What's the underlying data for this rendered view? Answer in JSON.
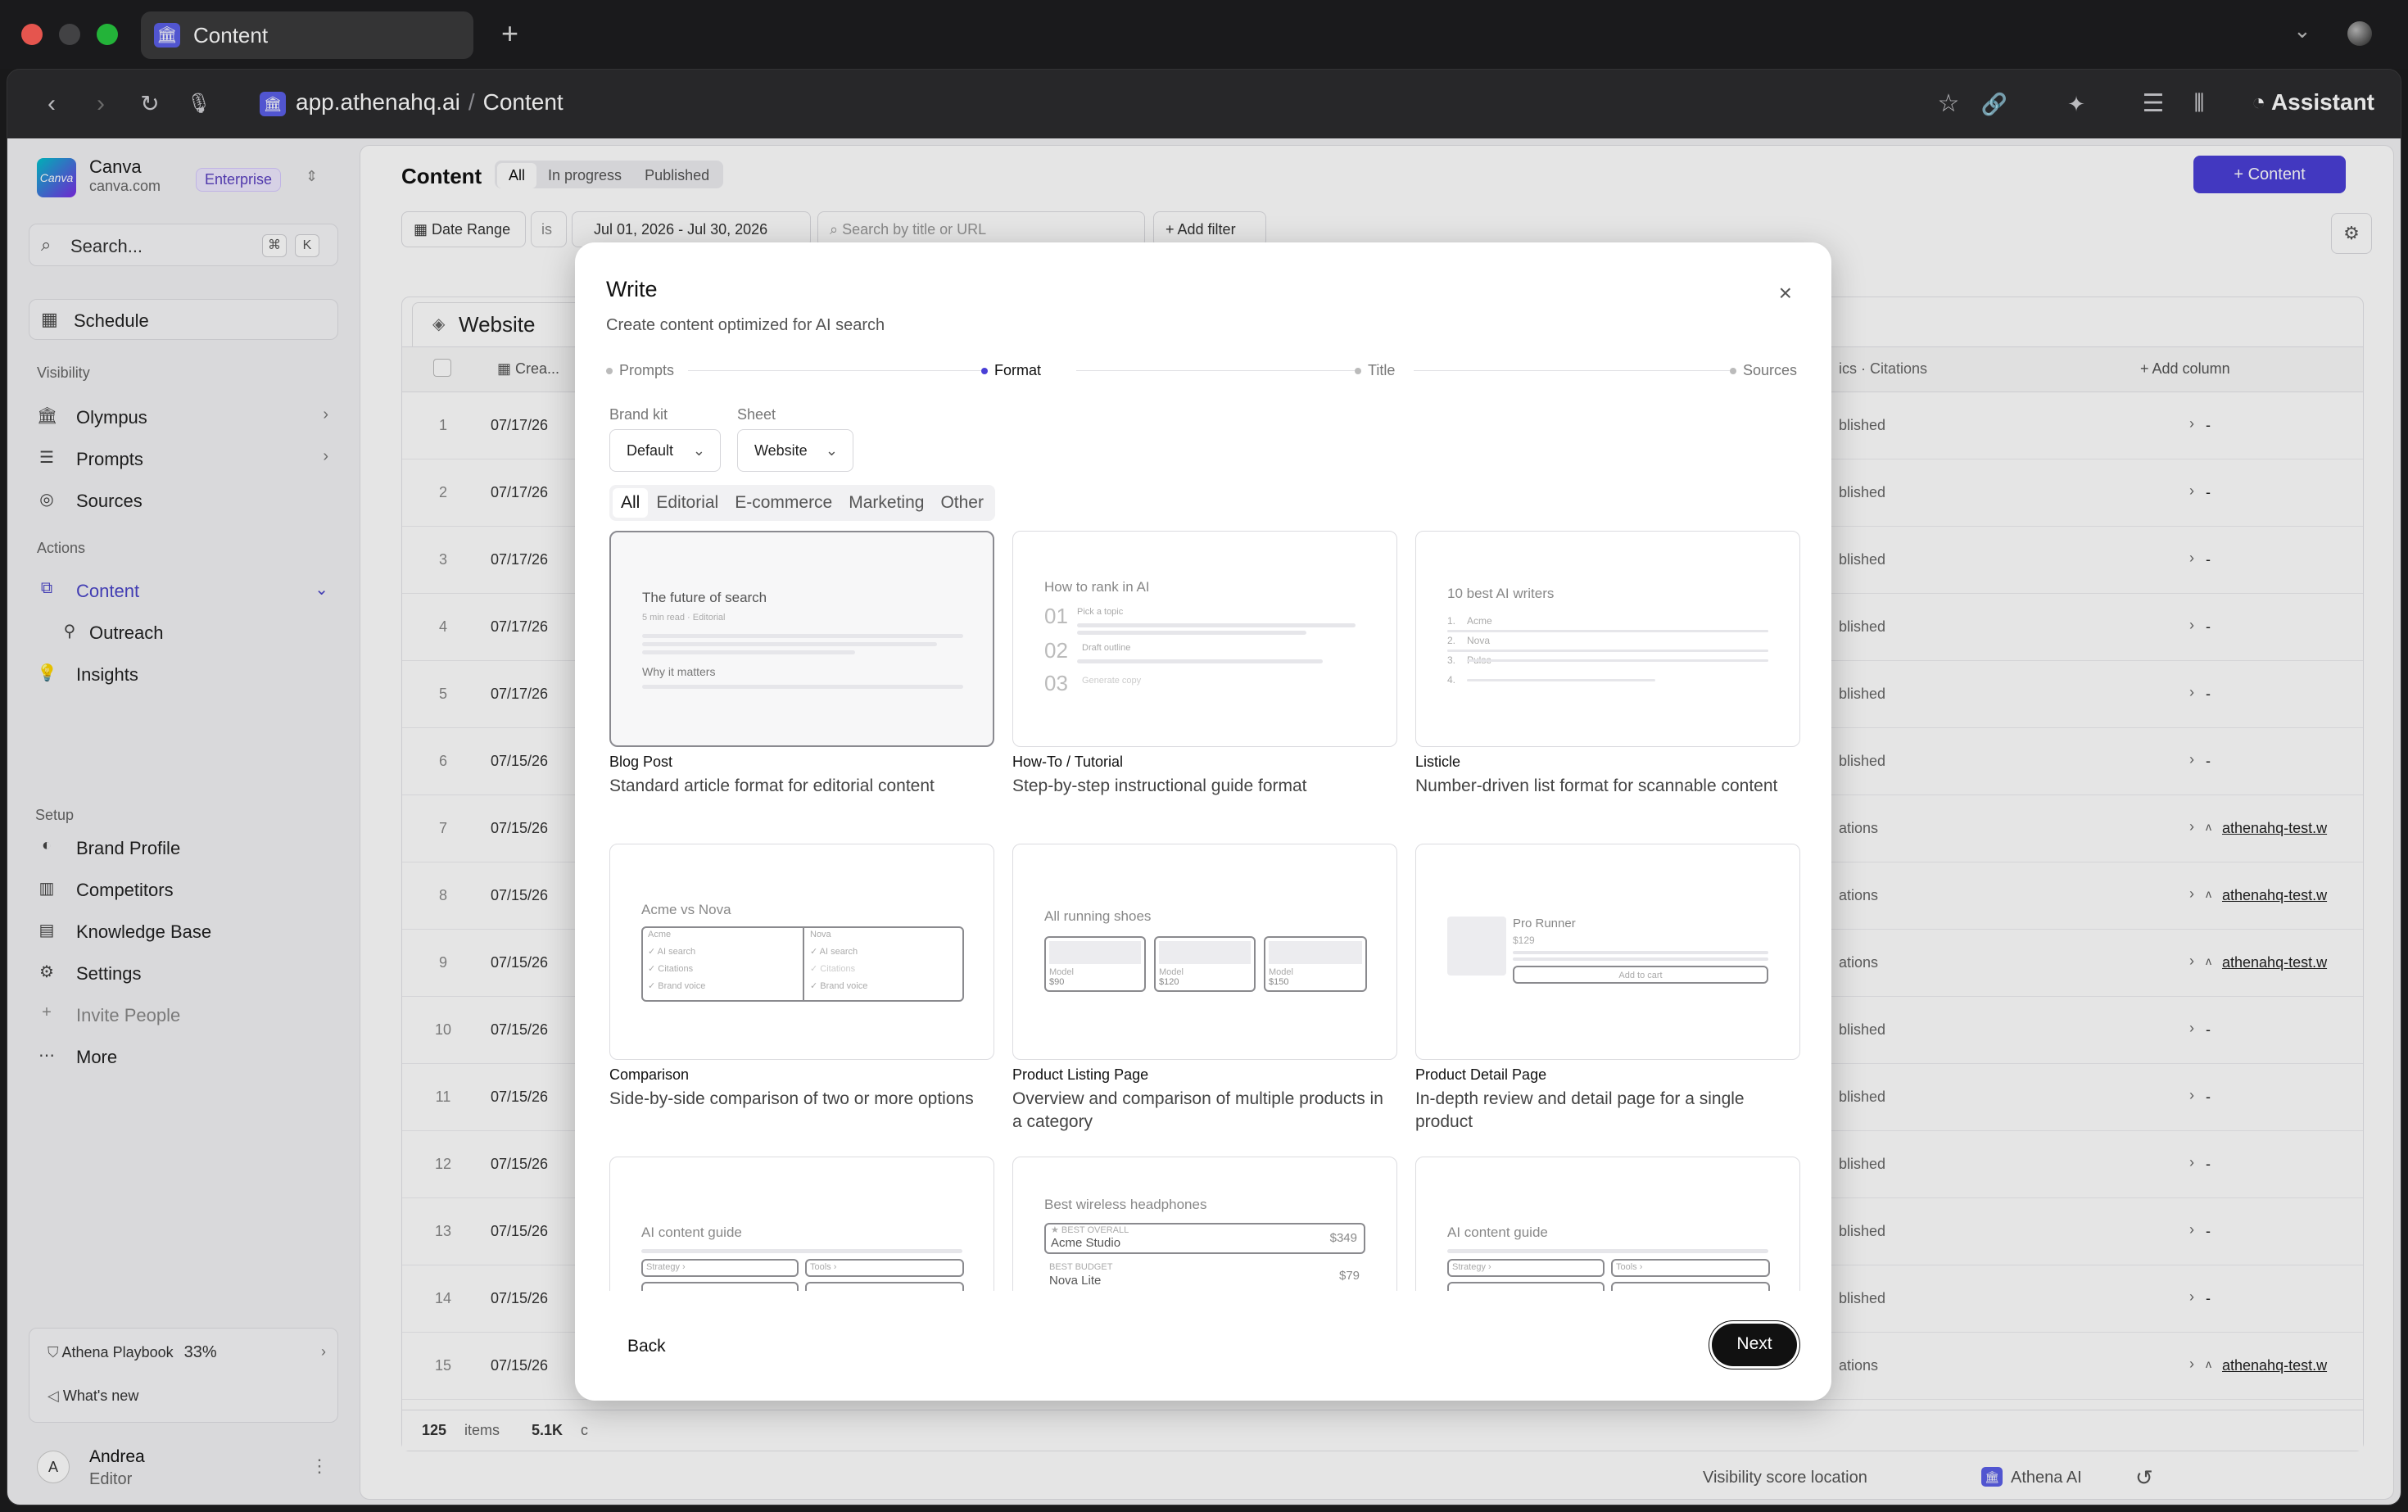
{
  "browser": {
    "tab_title": "Content",
    "url_domain": "app.athenahq.ai",
    "url_path": "Content",
    "assistant_label": "Assistant"
  },
  "sidebar": {
    "brand_name": "Canva",
    "brand_domain": "canva.com",
    "brand_logo_text": "Canva",
    "plan_badge": "Enterprise",
    "search_placeholder": "Search...",
    "search_kbd1": "⌘",
    "search_kbd2": "K",
    "schedule_label": "Schedule",
    "visibility_label": "Visibility",
    "visibility_items": [
      {
        "label": "Olympus",
        "icon": "bank-icon"
      },
      {
        "label": "Prompts",
        "icon": "list-icon"
      },
      {
        "label": "Sources",
        "icon": "globe-icon"
      }
    ],
    "actions_label": "Actions",
    "action_items": [
      {
        "label": "Content",
        "icon": "content-icon"
      },
      {
        "label": "Outreach",
        "icon": "person-icon"
      },
      {
        "label": "Insights",
        "icon": "lightbulb-icon"
      }
    ],
    "setup_label": "Setup",
    "setup_items": [
      {
        "label": "Brand Profile",
        "icon": "palette-icon"
      },
      {
        "label": "Competitors",
        "icon": "columns-icon"
      },
      {
        "label": "Knowledge Base",
        "icon": "book-icon"
      },
      {
        "label": "Settings",
        "icon": "gear-icon"
      },
      {
        "label": "Invite People",
        "icon": "plus-icon"
      },
      {
        "label": "More",
        "icon": "ellipsis-icon"
      }
    ],
    "playbook_label": "Athena Playbook",
    "playbook_progress": "33%",
    "whats_new": "What's new",
    "user_initial": "A",
    "user_name": "Andrea",
    "user_role": "Editor"
  },
  "main": {
    "page_title": "Content",
    "tabs": [
      "All",
      "In progress",
      "Published"
    ],
    "new_button": "Content",
    "filter_date_label": "Date Range",
    "filter_is": "is",
    "filter_date_value": "Jul 01, 2026 - Jul 30, 2026",
    "filter_search_placeholder": "Search by title or URL",
    "add_filter": "Add filter",
    "table_tab": "Website",
    "col_created": "Crea...",
    "col_metrics": "ics · Citations",
    "col_add": "Add column",
    "rows": [
      {
        "n": "1",
        "date": "07/17/26",
        "status": "blished",
        "dash": "-",
        "link": ""
      },
      {
        "n": "2",
        "date": "07/17/26",
        "status": "blished",
        "dash": "-",
        "link": ""
      },
      {
        "n": "3",
        "date": "07/17/26",
        "status": "blished",
        "dash": "-",
        "link": ""
      },
      {
        "n": "4",
        "date": "07/17/26",
        "status": "blished",
        "dash": "-",
        "link": ""
      },
      {
        "n": "5",
        "date": "07/17/26",
        "status": "blished",
        "dash": "-",
        "link": ""
      },
      {
        "n": "6",
        "date": "07/15/26",
        "status": "blished",
        "dash": "-",
        "link": ""
      },
      {
        "n": "7",
        "date": "07/15/26",
        "status": "ations",
        "dash": "",
        "link": "athenahq-test.w"
      },
      {
        "n": "8",
        "date": "07/15/26",
        "status": "ations",
        "dash": "",
        "link": "athenahq-test.w"
      },
      {
        "n": "9",
        "date": "07/15/26",
        "status": "ations",
        "dash": "",
        "link": "athenahq-test.w"
      },
      {
        "n": "10",
        "date": "07/15/26",
        "status": "blished",
        "dash": "-",
        "link": ""
      },
      {
        "n": "11",
        "date": "07/15/26",
        "status": "blished",
        "dash": "-",
        "link": ""
      },
      {
        "n": "12",
        "date": "07/15/26",
        "status": "blished",
        "dash": "-",
        "link": ""
      },
      {
        "n": "13",
        "date": "07/15/26",
        "status": "blished",
        "dash": "-",
        "link": ""
      },
      {
        "n": "14",
        "date": "07/15/26",
        "status": "blished",
        "dash": "-",
        "link": ""
      },
      {
        "n": "15",
        "date": "07/15/26",
        "status": "ations",
        "dash": "",
        "link": "athenahq-test.w"
      }
    ],
    "footer_count": "125",
    "footer_items": "items",
    "footer_total": "5.1K",
    "footer_c": "c"
  },
  "status_bar": {
    "visibility": "Visibility score location",
    "athena": "Athena AI"
  },
  "modal": {
    "title": "Write",
    "subtitle": "Create content optimized for AI search",
    "steps": [
      "Prompts",
      "Format",
      "Title",
      "Sources"
    ],
    "active_step": "Format",
    "brand_kit_label": "Brand kit",
    "brand_kit_value": "Default",
    "sheet_label": "Sheet",
    "sheet_value": "Website",
    "categories": [
      "All",
      "Editorial",
      "E-commerce",
      "Marketing",
      "Other"
    ],
    "formats": [
      {
        "name": "Blog Post",
        "desc": "Standard article format for editorial content"
      },
      {
        "name": "How-To / Tutorial",
        "desc": "Step-by-step instructional guide format"
      },
      {
        "name": "Listicle",
        "desc": "Number-driven list format for scannable content"
      },
      {
        "name": "Comparison",
        "desc": "Side-by-side comparison of two or more options"
      },
      {
        "name": "Product Listing Page",
        "desc": "Overview and comparison of multiple products in a category"
      },
      {
        "name": "Product Detail Page",
        "desc": "In-depth review and detail page for a single product"
      }
    ],
    "previews": {
      "blog_title": "The future of search",
      "blog_meta": "5 min read · Editorial",
      "blog_h2": "Why it matters",
      "howto_title": "How to rank in AI",
      "howto_steps": [
        {
          "n": "01",
          "t": "Pick a topic"
        },
        {
          "n": "02",
          "t": "Draft outline"
        },
        {
          "n": "03",
          "t": "Generate copy"
        }
      ],
      "listicle_title": "10 best AI writers",
      "listicle_items": [
        {
          "n": "1.",
          "t": "Acme"
        },
        {
          "n": "2.",
          "t": "Nova"
        },
        {
          "n": "3.",
          "t": "Pulse"
        },
        {
          "n": "4.",
          "t": ""
        }
      ],
      "comparison_title": "Acme vs Nova",
      "comparison_left": [
        "Acme",
        "✓ AI search",
        "✓ Citations",
        "✓ Brand voice"
      ],
      "comparison_right": [
        "Nova",
        "✓ AI search",
        "✓ Citations",
        "✓ Brand voice"
      ],
      "plp_title": "All running shoes",
      "plp_items": [
        {
          "model": "Model",
          "price": "$90"
        },
        {
          "model": "Model",
          "price": "$120"
        },
        {
          "model": "Model",
          "price": "$150"
        }
      ],
      "pdp_title": "Pro Runner",
      "pdp_price": "$129",
      "pdp_cart": "Add to cart",
      "guide1_title": "AI content guide",
      "guide1_tags": [
        "Strategy ›",
        "Tools ›"
      ],
      "headphones_title": "Best wireless headphones",
      "headphones_best_label": "★ BEST OVERALL",
      "headphones_best_name": "Acme Studio",
      "headphones_best_price": "$349",
      "headphones_budget_label": "BEST BUDGET",
      "headphones_budget_name": "Nova Lite",
      "headphones_budget_price": "$79",
      "guide2_title": "AI content guide",
      "guide2_tags": [
        "Strategy ›",
        "Tools ›"
      ]
    },
    "back_label": "Back",
    "next_label": "Next"
  }
}
